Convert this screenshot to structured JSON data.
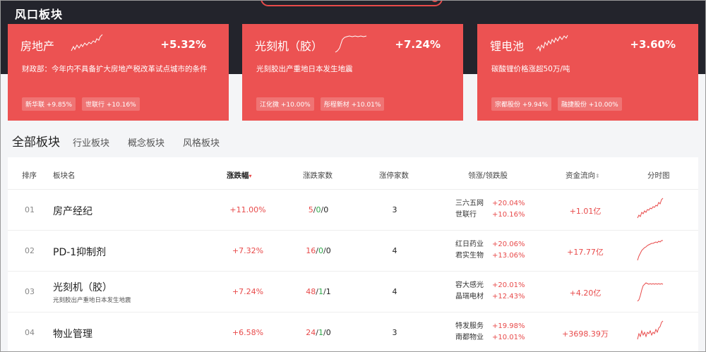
{
  "header": {
    "title": "风口板块"
  },
  "hot_cards": [
    {
      "name": "房地产",
      "pct": "+5.32%",
      "news": "财政部：今年内不具备扩大房地产税改革试点城市的条件",
      "tags": [
        "新华联 +9.85%",
        "世联行 +10.16%"
      ]
    },
    {
      "name": "光刻机（胶）",
      "pct": "+7.24%",
      "news": "光刻胶出产重地日本发生地震",
      "tags": [
        "江化微 +10.00%",
        "彤程新材 +10.01%"
      ]
    },
    {
      "name": "锂电池",
      "pct": "+3.60%",
      "news": "碳酸锂价格涨超50万/吨",
      "tags": [
        "宗都股份 +9.94%",
        "融捷股份 +10.00%"
      ]
    }
  ],
  "tabs": [
    "全部板块",
    "行业板块",
    "概念板块",
    "风格板块"
  ],
  "table": {
    "headers": {
      "rank": "排序",
      "name": "板块名",
      "change": "涨跌幅",
      "counts": "涨跌家数",
      "limit_up": "涨停家数",
      "leaders": "领涨/领跌股",
      "flow": "资金流向",
      "chart": "分时图"
    },
    "rows": [
      {
        "rank": "01",
        "name": "房产经纪",
        "sub": "",
        "change": "+11.00%",
        "up": "5",
        "flat": "0",
        "down": "0",
        "limit_up": "3",
        "lead1": "三六五网",
        "lead1_pct": "+20.04%",
        "lead2": "世联行",
        "lead2_pct": "+10.16%",
        "flow": "+1.01亿"
      },
      {
        "rank": "02",
        "name": "PD-1抑制剂",
        "sub": "",
        "change": "+7.32%",
        "up": "16",
        "flat": "0",
        "down": "0",
        "limit_up": "4",
        "lead1": "红日药业",
        "lead1_pct": "+20.06%",
        "lead2": "君实生物",
        "lead2_pct": "+13.06%",
        "flow": "+17.77亿"
      },
      {
        "rank": "03",
        "name": "光刻机（胶）",
        "sub": "光刻胶出产重地日本发生地震",
        "change": "+7.24%",
        "up": "48",
        "flat": "1",
        "down": "1",
        "limit_up": "4",
        "lead1": "容大感光",
        "lead1_pct": "+20.01%",
        "lead2": "晶瑞电材",
        "lead2_pct": "+12.43%",
        "flow": "+4.20亿"
      },
      {
        "rank": "04",
        "name": "物业管理",
        "sub": "",
        "change": "+6.58%",
        "up": "24",
        "flat": "1",
        "down": "0",
        "limit_up": "3",
        "lead1": "特发服务",
        "lead1_pct": "+19.98%",
        "lead2": "南都物业",
        "lead2_pct": "+10.01%",
        "flow": "+3698.39万"
      }
    ]
  },
  "colors": {
    "accent_red": "#ec5252",
    "up": "#e84a4a",
    "flat": "#2ea84a",
    "dark_band": "#23242c"
  }
}
